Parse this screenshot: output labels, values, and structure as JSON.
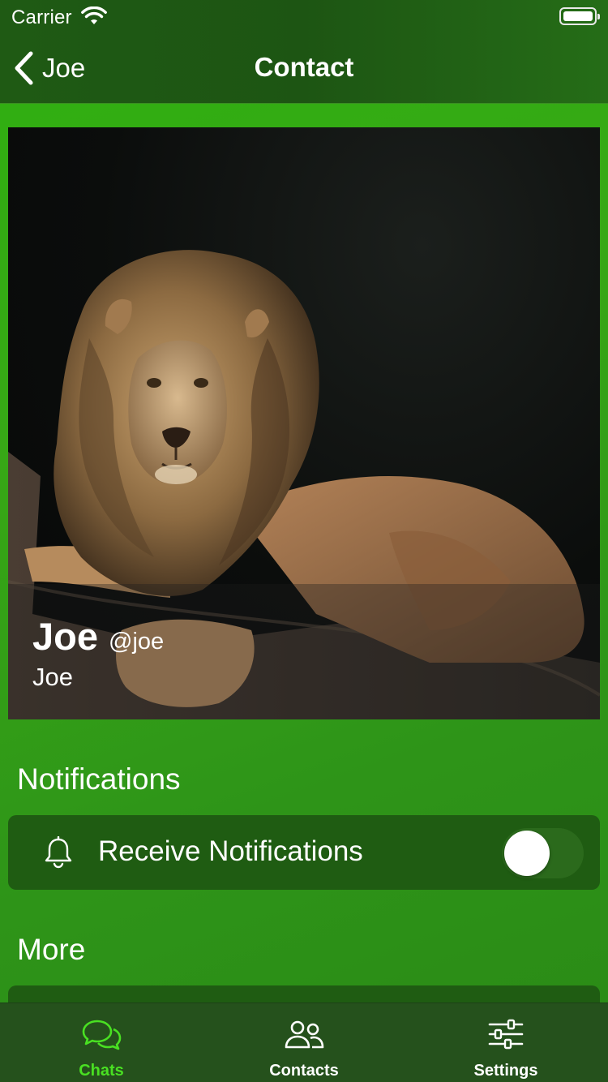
{
  "status_bar": {
    "carrier": "Carrier"
  },
  "nav": {
    "back_label": "Joe",
    "title": "Contact"
  },
  "contact": {
    "display_name": "Joe",
    "handle": "@joe",
    "subtitle": "Joe"
  },
  "sections": {
    "notifications": {
      "title": "Notifications",
      "row_label": "Receive Notifications",
      "toggle_on": false
    },
    "more": {
      "title": "More"
    }
  },
  "tabs": [
    {
      "label": "Chats",
      "icon": "chat-bubbles-icon",
      "active": true
    },
    {
      "label": "Contacts",
      "icon": "people-icon",
      "active": false
    },
    {
      "label": "Settings",
      "icon": "sliders-icon",
      "active": false
    }
  ],
  "colors": {
    "accent": "#49e022",
    "header": "#1f5a14",
    "card": "#1f5c12",
    "tabbar": "#25511c"
  }
}
